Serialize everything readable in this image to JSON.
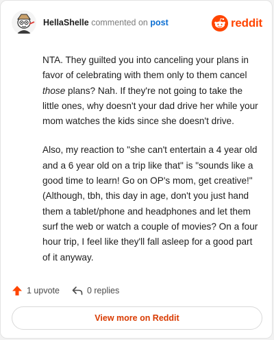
{
  "comment": {
    "username": "HellaShelle",
    "action": "commented on",
    "post_link": "post",
    "paragraph1_part1": "NTA. They guilted you into canceling your plans in favor of celebrating with them only to them cancel ",
    "paragraph1_emphasis": "those",
    "paragraph1_part2": " plans? Nah. If they're not going to take the little ones, why doesn't your dad drive her while your mom watches the kids since she doesn't drive.",
    "paragraph2": "Also, my reaction to \"she can't entertain a 4 year old and a 6 year old on a trip like that\" is \"sounds like a good time to learn! Go on OP's mom, get creative!\" (Although, tbh, this day in age, don't you just hand them a tablet/phone and headphones and let them surf the web or watch a couple of movies? On a four hour trip, I feel like they'll fall asleep for a good part of it anyway."
  },
  "brand": {
    "wordmark": "reddit",
    "logo_icon": "reddit-alien-icon"
  },
  "footer": {
    "upvotes": "1 upvote",
    "replies": "0 replies",
    "upvote_icon": "upvote-arrow-icon",
    "reply_icon": "reply-arrow-icon"
  },
  "cta": {
    "label": "View more on Reddit"
  },
  "colors": {
    "brand_orange": "#ff4500",
    "link_blue": "#0b6ed2",
    "cta_text": "#d93a00",
    "upvote": "#ff4500"
  }
}
